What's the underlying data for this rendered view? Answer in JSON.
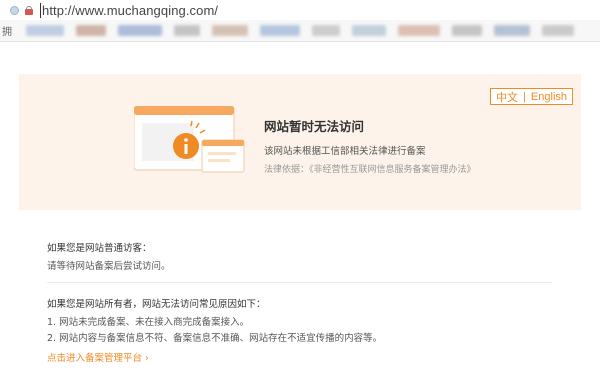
{
  "browser": {
    "url_prefix": "http://",
    "url_rest": "www.muchangqing.com/",
    "bookmark_first": "拥"
  },
  "colors": {
    "accent": "#f08a24",
    "banner_bg": "#fdf3ea",
    "bookmark_blobs": [
      "#b7c7e0",
      "#c9a99a",
      "#9fb2d4",
      "#bcbcbc",
      "#d0b8a8",
      "#a8bedc",
      "#c6c6c6",
      "#b9c9d9",
      "#d7b7a7",
      "#bdbdbd",
      "#a9b9d0",
      "#c3c3c3"
    ]
  },
  "lang_switch": {
    "zh": "中文",
    "sep": "|",
    "en": "English"
  },
  "notice": {
    "title": "网站暂时无法访问",
    "subtitle": "该网站未根据工信部相关法律进行备案",
    "law": "法律依据：《非经营性互联网信息服务备案管理办法》"
  },
  "visitor": {
    "heading": "如果您是网站普通访客：",
    "text": "请等待网站备案后尝试访问。"
  },
  "owner": {
    "heading": "如果您是网站所有者，网站无法访问常见原因如下：",
    "reasons": [
      "1. 网站未完成备案、未在接入商完成备案接入。",
      "2. 网站内容与备案信息不符、备案信息不准确、网站存在不适宜传播的内容等。"
    ]
  },
  "link": {
    "label": "点击进入备案管理平台 ›"
  }
}
